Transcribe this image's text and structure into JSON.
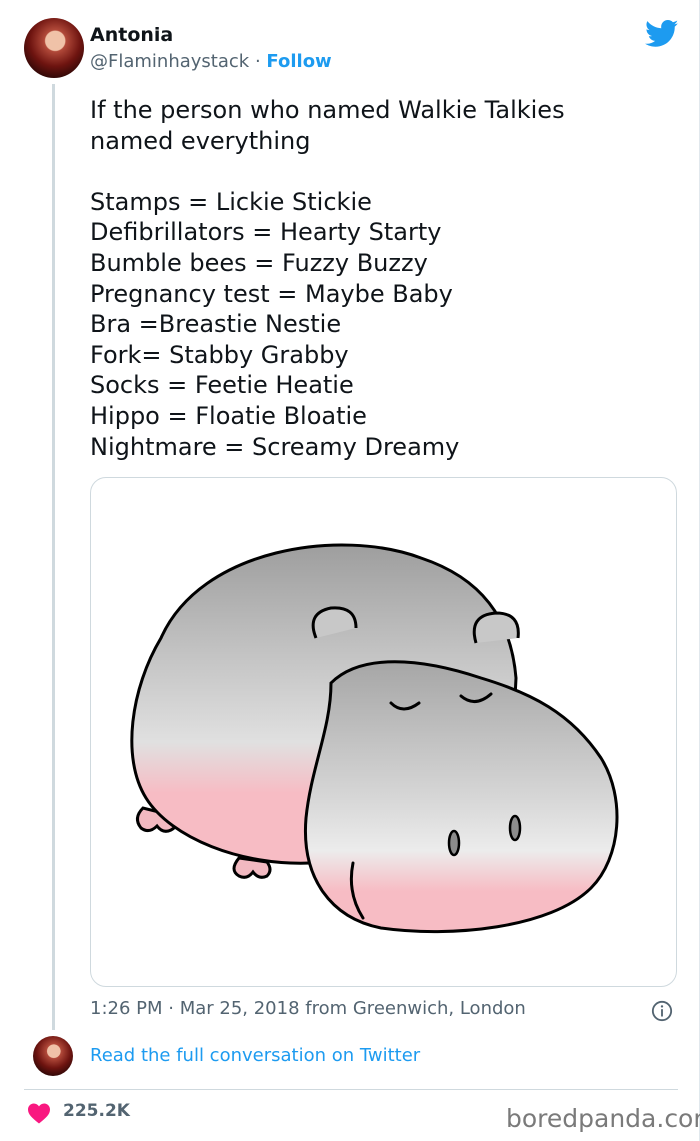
{
  "author": {
    "name": "Antonia",
    "handle": "@Flaminhaystack",
    "separator": "·",
    "follow_label": "Follow"
  },
  "tweet": {
    "text": "If the person who named Walkie Talkies\nnamed everything\n\nStamps = Lickie Stickie\nDefibrillators = Hearty Starty\nBumble bees = Fuzzy Buzzy\nPregnancy test = Maybe Baby\nBra =Breastie Nestie\nFork= Stabby Grabby\nSocks = Feetie Heatie\nHippo = Floatie Bloatie\nNightmare = Screamy Dreamy",
    "meta": "1:26 PM · Mar 25, 2018 from Greenwich, London"
  },
  "media": {
    "subject": "hippo-illustration"
  },
  "footer": {
    "read_link": "Read the full conversation on Twitter",
    "likes": "225.2K"
  },
  "watermark": "boredpanda.com",
  "colors": {
    "brand": "#1d9bf0",
    "heart": "#f91880",
    "hippo_gray": "#b4b4b4",
    "hippo_pink": "#f7bcc4"
  },
  "icons": [
    "twitter-bird-icon",
    "info-icon",
    "heart-icon"
  ]
}
